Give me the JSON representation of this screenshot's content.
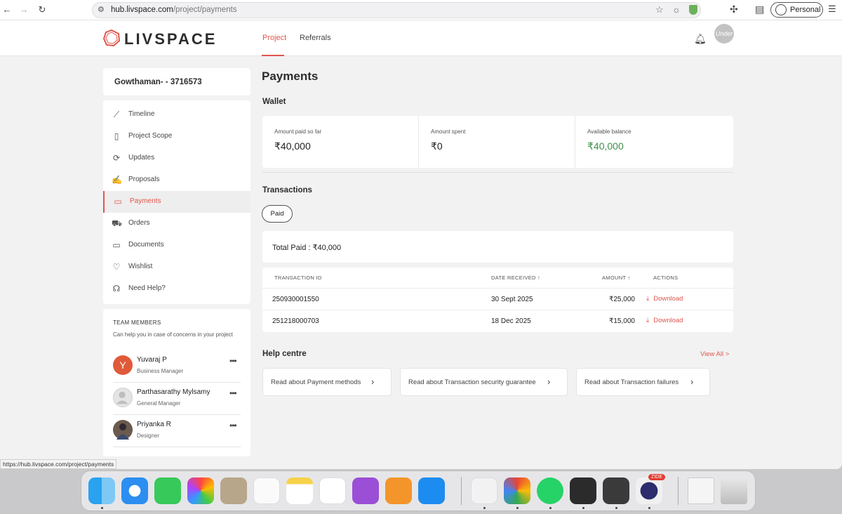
{
  "browser": {
    "url_host": "hub.livspace.com",
    "url_path": "/project/payments",
    "profile_label": "Personal",
    "status_url": "https://hub.livspace.com/project/payments"
  },
  "header": {
    "logo": "LIVSPACE",
    "tabs": [
      {
        "label": "Project"
      },
      {
        "label": "Referrals"
      }
    ],
    "avatar_text": "Under"
  },
  "sidebar": {
    "project_name": "Gowthaman- - 3716573",
    "items": [
      {
        "label": "Timeline",
        "icon": "trend-icon"
      },
      {
        "label": "Project Scope",
        "icon": "document-icon"
      },
      {
        "label": "Updates",
        "icon": "refresh-icon"
      },
      {
        "label": "Proposals",
        "icon": "proposal-icon"
      },
      {
        "label": "Payments",
        "icon": "cash-icon"
      },
      {
        "label": "Orders",
        "icon": "truck-icon"
      },
      {
        "label": "Documents",
        "icon": "folder-icon"
      },
      {
        "label": "Wishlist",
        "icon": "heart-icon"
      },
      {
        "label": "Need Help?",
        "icon": "headset-icon"
      }
    ]
  },
  "team": {
    "title": "TEAM MEMBERS",
    "subtitle": "Can help you in case of concerns in your project",
    "members": [
      {
        "name": "Yuvaraj P",
        "role": "Business Manager",
        "initial": "Y"
      },
      {
        "name": "Parthasarathy Mylsamy",
        "role": "General Manager"
      },
      {
        "name": "Priyanka R",
        "role": "Designer"
      }
    ]
  },
  "main": {
    "title": "Payments",
    "wallet_title": "Wallet",
    "wallet": [
      {
        "label": "Amount paid so far",
        "value": "₹40,000"
      },
      {
        "label": "Amount spent",
        "value": "₹0"
      },
      {
        "label": "Available balance",
        "value": "₹40,000"
      }
    ],
    "transactions_title": "Transactions",
    "filter_pill": "Paid",
    "total_paid": "Total Paid : ₹40,000",
    "table": {
      "headers": [
        "TRANSACTION ID",
        "DATE RECEIVED ↑",
        "AMOUNT ↑",
        "ACTIONS"
      ],
      "rows": [
        {
          "id": "250930001550",
          "date": "30 Sept 2025",
          "amount": "₹25,000",
          "action": "Download"
        },
        {
          "id": "251218000703",
          "date": "18 Dec 2025",
          "amount": "₹15,000",
          "action": "Download"
        }
      ]
    },
    "help_title": "Help centre",
    "view_all": "View All >",
    "help_links": [
      {
        "label": "Read about Payment methods"
      },
      {
        "label": "Read about Transaction security guarantee"
      },
      {
        "label": "Read about Transaction failures"
      }
    ]
  },
  "colors": {
    "accent": "#e0564e",
    "balance_green": "#3e8e4a"
  },
  "dock": {
    "badge": "ZIDE"
  }
}
